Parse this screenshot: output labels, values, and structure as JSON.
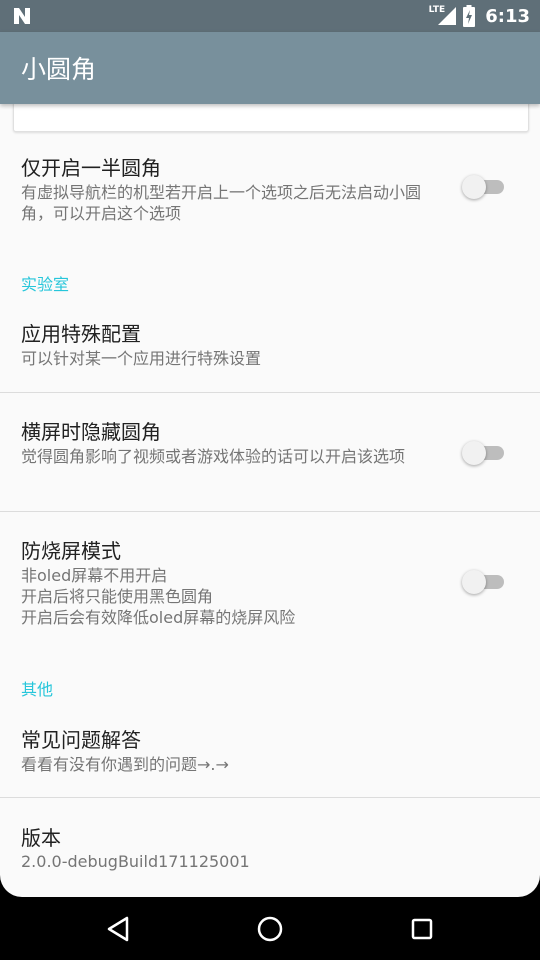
{
  "status_bar": {
    "network_label": "LTE",
    "time": "6:13",
    "icons": [
      "n-logo-icon",
      "signal-icon",
      "battery-icon"
    ]
  },
  "app_bar": {
    "title": "小圆角"
  },
  "settings": {
    "half_corner": {
      "title": "仅开启一半圆角",
      "subtitle": "有虚拟导航栏的机型若开启上一个选项之后无法启动小圆角，可以开启这个选项",
      "enabled": false
    },
    "lab_header": "实验室",
    "app_config": {
      "title": "应用特殊配置",
      "subtitle": "可以针对某一个应用进行特殊设置"
    },
    "landscape_hide": {
      "title": "横屏时隐藏圆角",
      "subtitle": "觉得圆角影响了视频或者游戏体验的话可以开启该选项",
      "enabled": false
    },
    "burn_in": {
      "title": "防烧屏模式",
      "subtitle_line1": "非oled屏幕不用开启",
      "subtitle_line2": "开启后将只能使用黑色圆角",
      "subtitle_line3": "开启后会有效降低oled屏幕的烧屏风险",
      "enabled": false
    },
    "other_header": "其他",
    "faq": {
      "title": "常见问题解答",
      "subtitle": "看看有没有你遇到的问题→.→"
    },
    "version": {
      "title": "版本",
      "value": "2.0.0-debugBuild171125001"
    }
  },
  "colors": {
    "status_bar": "#5f6f78",
    "app_bar": "#78909c",
    "accent": "#26c6da",
    "background": "#fafafa"
  },
  "nav_bar": {
    "icons": [
      "back-icon",
      "home-icon",
      "recents-icon"
    ]
  }
}
